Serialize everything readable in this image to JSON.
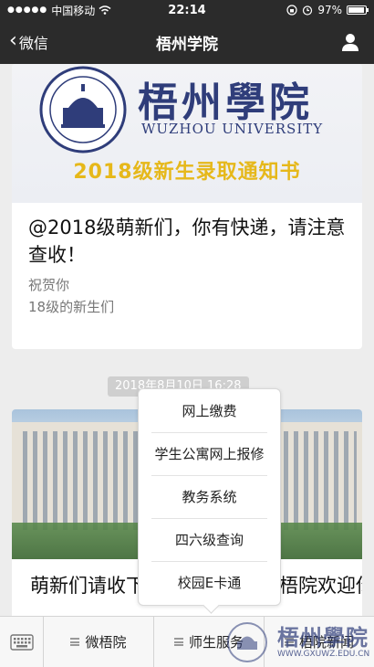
{
  "status_bar": {
    "carrier": "中国移动",
    "time": "22:14",
    "battery_text": "97%",
    "battery_level": 0.97,
    "icons": [
      "signal-dots",
      "wifi-icon",
      "lock-rotation-icon",
      "alarm-icon",
      "battery-icon"
    ]
  },
  "nav": {
    "back_label": "微信",
    "title": "梧州学院",
    "profile_icon": "person-icon"
  },
  "articles": [
    {
      "banner": {
        "school_name_cn": "梧州學院",
        "school_name_en": "WUZHOU UNIVERSITY",
        "notice": "2018级新生录取通知书"
      },
      "headline": "@2018级萌新们，你有快递，请注意查收！",
      "desc_line1": "祝贺你",
      "desc_line2": "18级的新生们"
    },
    {
      "timestamp": "2018年8月10日 16:28",
      "headline": "萌新们请收下这份入学指南，梧院欢迎你来学校！"
    }
  ],
  "popup_menu": {
    "items": [
      "网上缴费",
      "学生公寓网上报修",
      "教务系统",
      "四六级查询",
      "校园E卡通"
    ]
  },
  "bottom_bar": {
    "keyboard_icon": "keyboard-icon",
    "tabs": [
      "微梧院",
      "师生服务",
      "梧院新闻"
    ]
  },
  "watermark": {
    "text": "梧州學院",
    "url": "WWW.GXUWZ.EDU.CN"
  },
  "colors": {
    "nav_bg": "#2b2b2b",
    "brand_blue": "#2f3d7a",
    "notice_gold": "#e6b81a"
  }
}
